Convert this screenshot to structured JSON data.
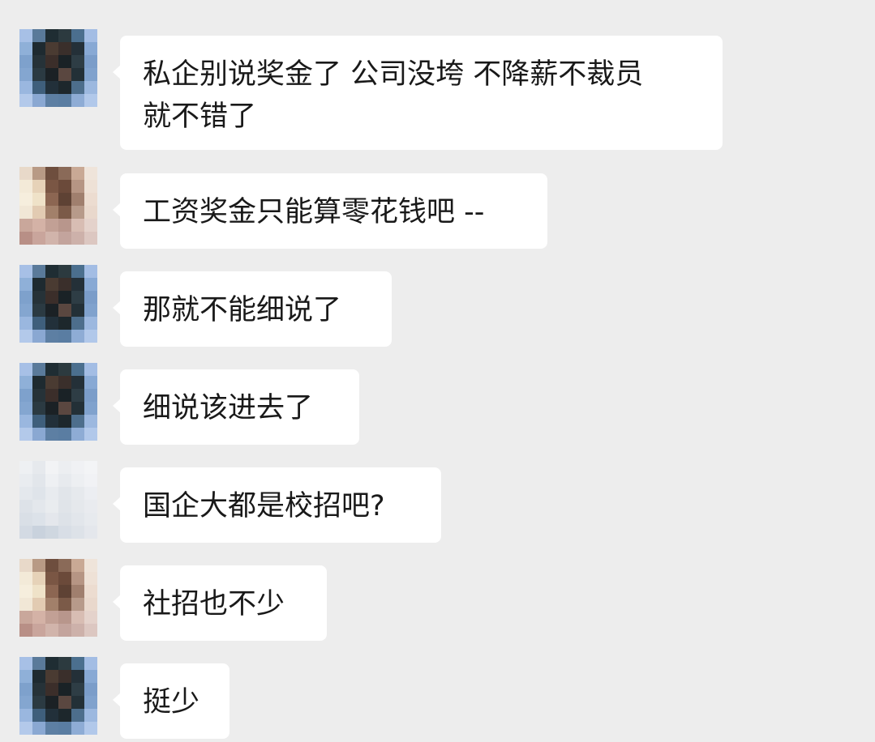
{
  "messages": [
    {
      "sender": "a",
      "lines": [
        "私企别说奖金了 公司没垮 不降薪不裁员",
        "就不错了"
      ]
    },
    {
      "sender": "b",
      "lines": [
        "工资奖金只能算零花钱吧 --"
      ]
    },
    {
      "sender": "a",
      "lines": [
        "那就不能细说了"
      ]
    },
    {
      "sender": "a",
      "lines": [
        "细说该进去了"
      ]
    },
    {
      "sender": "c",
      "lines": [
        "国企大都是校招吧?"
      ]
    },
    {
      "sender": "b",
      "lines": [
        "社招也不少"
      ]
    },
    {
      "sender": "a",
      "lines": [
        "挺少"
      ]
    }
  ],
  "colors": {
    "background": "#ededed",
    "bubble": "#ffffff",
    "text": "#191919"
  },
  "avatars": {
    "a": [
      "#a7c0e6",
      "#5a7a9a",
      "#1f2d33",
      "#2c3a3f",
      "#4b6f8e",
      "#a3bde4",
      "#8fb0d8",
      "#1e2a30",
      "#4a3b32",
      "#3a2f2b",
      "#243038",
      "#88a9d4",
      "#7ea1cc",
      "#263238",
      "#3b2e2a",
      "#1a2226",
      "#2e3d45",
      "#7b9dc9",
      "#84a6d0",
      "#2b3a42",
      "#1b2125",
      "#5a4740",
      "#233037",
      "#80a2cd",
      "#9ab7df",
      "#3f5f7c",
      "#22303a",
      "#1d272c",
      "#4d6e8c",
      "#9cb8df",
      "#b3c9ea",
      "#8aa8d2",
      "#5d7fa3",
      "#5a7da2",
      "#8eacd5",
      "#b1c8ea"
    ],
    "b": [
      "#e8d9c9",
      "#b89a85",
      "#6e4e3e",
      "#8a6a58",
      "#c9a995",
      "#efe4da",
      "#f3ead8",
      "#e6d2b8",
      "#7a5644",
      "#6b4a3a",
      "#b69584",
      "#eee1d6",
      "#f6eedd",
      "#efe2c8",
      "#8c6652",
      "#5e4234",
      "#a07f6e",
      "#ecdcd0",
      "#f1e7d6",
      "#e2cbb2",
      "#a2806a",
      "#7b5a48",
      "#b79a8a",
      "#e9d8cc",
      "#c9a79b",
      "#d4b2a6",
      "#c2a095",
      "#b8968c",
      "#d8bdb3",
      "#e4d2cb",
      "#b88f86",
      "#c9a59c",
      "#d1b4ab",
      "#c3a49d",
      "#cdb1aa",
      "#dcc7c1"
    ],
    "c": [
      "#eef0f3",
      "#e6e9ed",
      "#f2f3f5",
      "#eceef1",
      "#f0f1f4",
      "#f3f4f6",
      "#e9ecf0",
      "#e2e6eb",
      "#eef0f3",
      "#e7eaee",
      "#edeff2",
      "#f1f2f5",
      "#e4e8ed",
      "#dfe4ea",
      "#e8ebef",
      "#e1e5ea",
      "#e6e9ed",
      "#eceef2",
      "#dde2e8",
      "#e3e7ec",
      "#e9ecef",
      "#e0e4e9",
      "#e5e8ec",
      "#e9ebef",
      "#d9dfe6",
      "#dce2e9",
      "#e4e7ec",
      "#dde2e8",
      "#e2e6eb",
      "#e7eaee",
      "#d3dae3",
      "#c9d2dd",
      "#cfd7e0",
      "#d8dee6",
      "#dde2e8",
      "#e4e7ec"
    ]
  }
}
